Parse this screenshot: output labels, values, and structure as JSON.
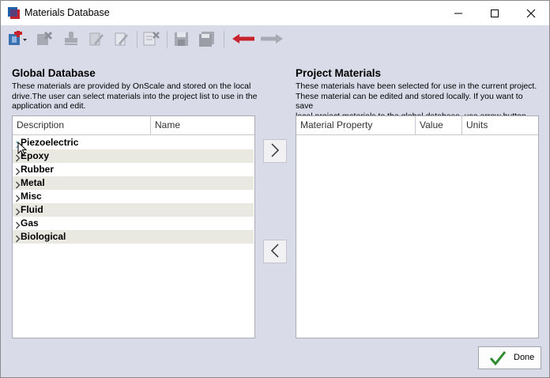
{
  "window": {
    "title": "Materials Database"
  },
  "toolbar": {
    "buttons": [
      {
        "icon": "add-material-icon",
        "enabled": true
      },
      {
        "icon": "delete-material-icon",
        "enabled": false
      },
      {
        "icon": "stamp-icon",
        "enabled": false
      },
      {
        "icon": "edit-properties-icon",
        "enabled": false
      },
      {
        "icon": "edit-icon",
        "enabled": false
      },
      {
        "icon": "clear-list-icon",
        "enabled": false
      },
      {
        "icon": "save-icon",
        "enabled": false
      },
      {
        "icon": "save-all-icon",
        "enabled": false
      },
      {
        "icon": "arrow-left-icon",
        "enabled": true
      },
      {
        "icon": "arrow-right-icon",
        "enabled": false
      }
    ]
  },
  "global": {
    "heading": "Global Database",
    "description_1": "These materials are provided by OnScale and stored on the local",
    "description_2": "drive.The user can select materials into the project list to use in the",
    "description_3": "application and edit.",
    "columns": [
      "Description",
      "Name"
    ],
    "items": [
      {
        "label": "Piezoelectric"
      },
      {
        "label": "Epoxy"
      },
      {
        "label": "Rubber"
      },
      {
        "label": "Metal"
      },
      {
        "label": "Misc"
      },
      {
        "label": "Fluid"
      },
      {
        "label": "Gas"
      },
      {
        "label": "Biological"
      }
    ]
  },
  "project": {
    "heading": "Project Materials",
    "description_1": "These materials have been selected for use in the current project.",
    "description_2": "These material can be edited and stored locally. If you want to save",
    "description_3": "local project materials to the global database, use arrow button.",
    "columns": [
      "Material Property",
      "Value",
      "Units"
    ]
  },
  "buttons": {
    "done": "Done"
  },
  "colors": {
    "panel_bg": "#d9dce8",
    "alt_row": "#e9e8e1",
    "accent_red": "#c8232c",
    "check_green": "#2e8b2e"
  }
}
